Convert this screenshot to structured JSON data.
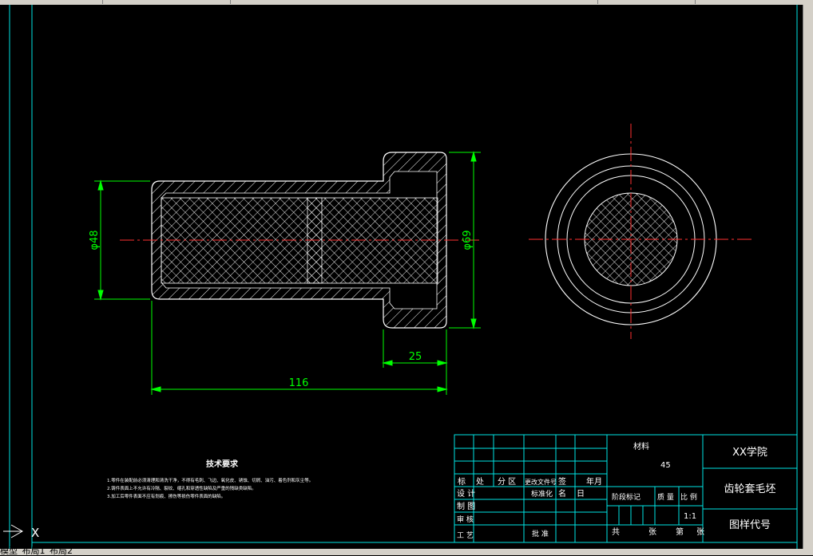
{
  "drawing": {
    "dimensions": {
      "left_diameter": "φ48",
      "right_diameter": "φ69",
      "flange_length": "25",
      "total_length": "116"
    }
  },
  "tech_requirements": {
    "title": "技术要求",
    "items": [
      "1.零件在装配前必须清理和清洗干净，不得有毛刺、飞边、氧化皮、锈蚀、切屑、油污、着色剂和灰尘等。",
      "2.铸件表面上不允许有冷隔、裂纹、缩孔和穿透性缺陷及严重的残缺类缺陷。",
      "3.加工后零件表面不应有划痕、擦伤等损伤零件表面的缺陷。"
    ]
  },
  "title_block": {
    "material_label": "材料",
    "material_value": "45",
    "school": "XX学院",
    "part_name": "齿轮套毛坯",
    "drawing_code": "图样代号",
    "scale_value": "1:1",
    "row_labels": [
      "标",
      "处",
      "分 区",
      "更改文件号",
      "签",
      "年月"
    ],
    "design": "设 计",
    "draw": "制 图",
    "standardize": "标准化",
    "name": "名",
    "date": "日",
    "stage_mark": "阶段标记",
    "weight": "质 量",
    "scale": "比 例",
    "check": "审 核",
    "process": "工 艺",
    "approve": "批 准",
    "total": "共",
    "sheets": "张",
    "page": "第",
    "sheet2": "张"
  },
  "ucs": {
    "x_label": "X"
  },
  "tabs": [
    "模型",
    "布局1",
    "布局2"
  ],
  "colors": {
    "background": "#000000",
    "outline": "#ffffff",
    "frame": "#00e5e5",
    "dimension": "#00ff00",
    "centerline": "#ff3030"
  }
}
